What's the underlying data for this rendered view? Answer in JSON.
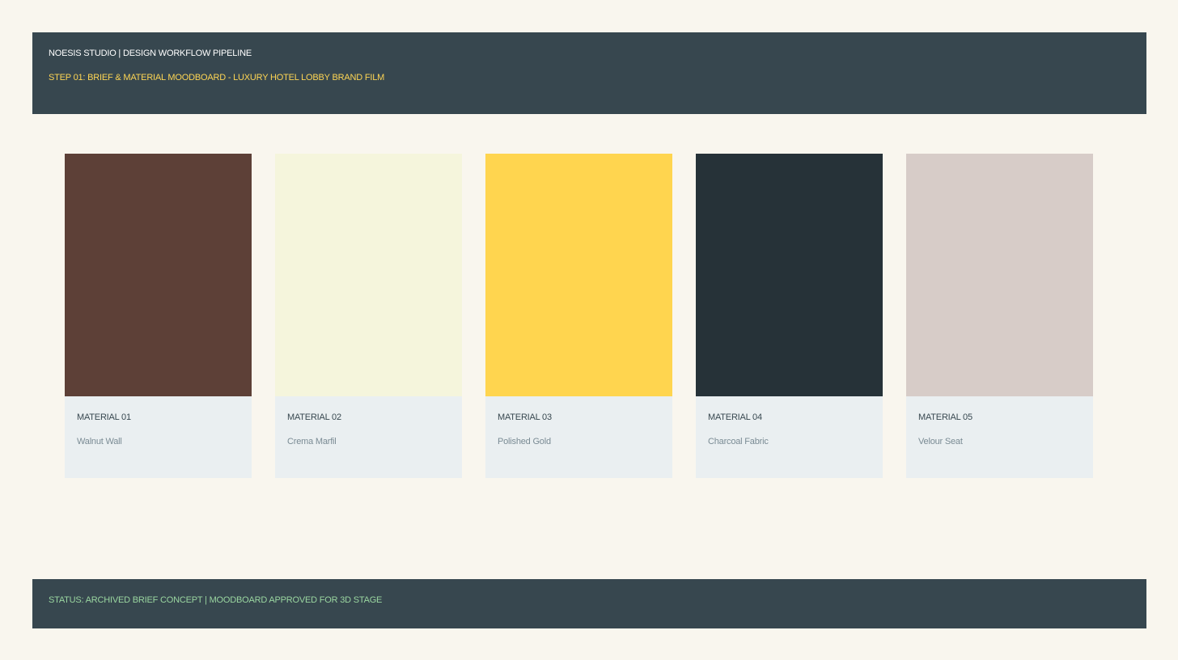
{
  "header": {
    "title": "NOESIS STUDIO | DESIGN WORKFLOW PIPELINE",
    "subtitle": "STEP 01: BRIEF & MATERIAL MOODBOARD - LUXURY HOTEL LOBBY BRAND FILM"
  },
  "materials": [
    {
      "label": "MATERIAL 01",
      "name": "Walnut Wall",
      "color": "#5d4037"
    },
    {
      "label": "MATERIAL 02",
      "name": "Crema Marfil",
      "color": "#f5f5dc"
    },
    {
      "label": "MATERIAL 03",
      "name": "Polished Gold",
      "color": "#ffd54f"
    },
    {
      "label": "MATERIAL 04",
      "name": "Charcoal Fabric",
      "color": "#263238"
    },
    {
      "label": "MATERIAL 05",
      "name": "Velour Seat",
      "color": "#d7ccc8"
    }
  ],
  "footer": {
    "status": "STATUS: ARCHIVED BRIEF CONCEPT | MOODBOARD APPROVED FOR 3D STAGE"
  },
  "colors": {
    "panel": "#37474f",
    "accent": "#fdd554",
    "status": "#9ad6a0",
    "page_background": "#f9f6ee",
    "card_info_background": "#eaeff1"
  }
}
